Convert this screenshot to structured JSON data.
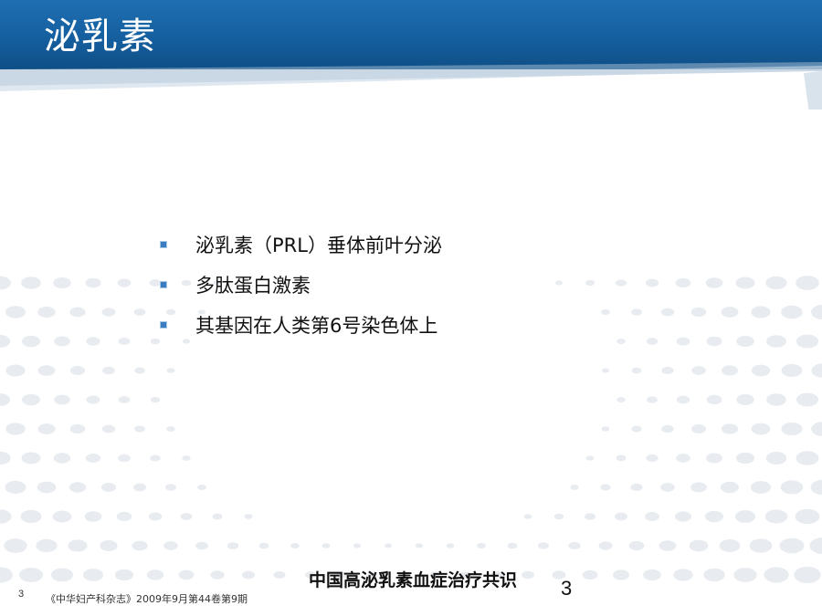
{
  "slide": {
    "title": "泌乳素",
    "bullets": [
      "泌乳素（PRL）垂体前叶分泌",
      "多肽蛋白激素",
      "其基因在人类第6号染色体上"
    ]
  },
  "footer": {
    "page_number_small": "3",
    "source": "《中华妇产科杂志》2009年9月第44卷第9期",
    "center_title": "中国高泌乳素血症治疗共识",
    "page_number_large": "3"
  },
  "colors": {
    "header_blue": "#1f6fb2",
    "bullet_blue": "#3a7cc0",
    "dot_gray": "#e8ecf0"
  }
}
